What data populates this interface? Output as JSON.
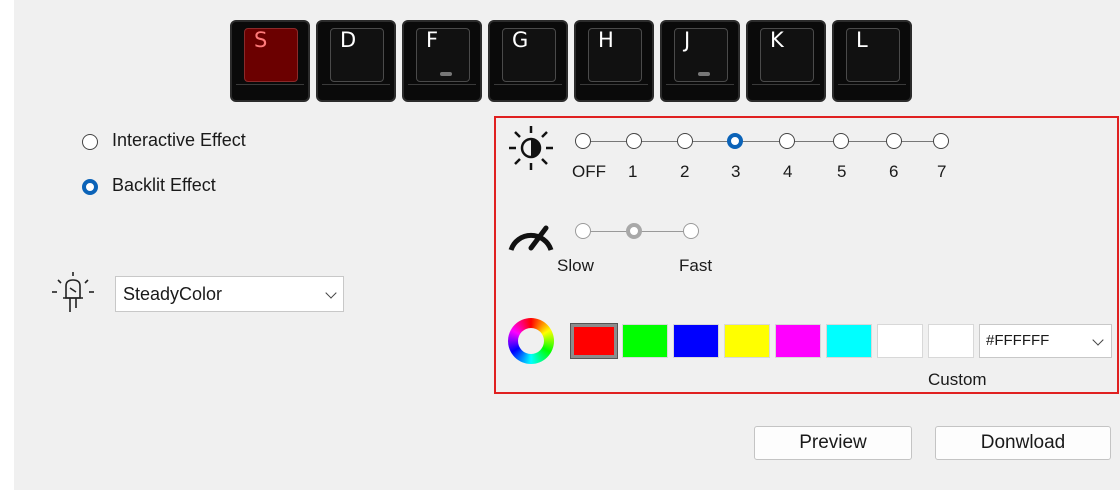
{
  "keys": [
    "S",
    "D",
    "F",
    "G",
    "H",
    "J",
    "K",
    "L"
  ],
  "selected_key": "S",
  "mode": {
    "interactive_label": "Interactive Effect",
    "backlit_label": "Backlit Effect",
    "selected": "Backlit Effect"
  },
  "effect": {
    "value": "SteadyColor"
  },
  "brightness": {
    "levels": [
      "OFF",
      "1",
      "2",
      "3",
      "4",
      "5",
      "6",
      "7"
    ],
    "selected": "3"
  },
  "speed": {
    "slow_label": "Slow",
    "fast_label": "Fast",
    "selected_index": 1
  },
  "colors": {
    "swatches": [
      "#FF0000",
      "#00FF00",
      "#0000FF",
      "#FFFF00",
      "#FF00FF",
      "#00FFFF",
      "#FFFFFF",
      "#FFFFFF"
    ],
    "selected": "#FF0000",
    "hex_value": "#FFFFFF",
    "custom_label": "Custom"
  },
  "buttons": {
    "preview": "Preview",
    "download": "Donwload"
  }
}
